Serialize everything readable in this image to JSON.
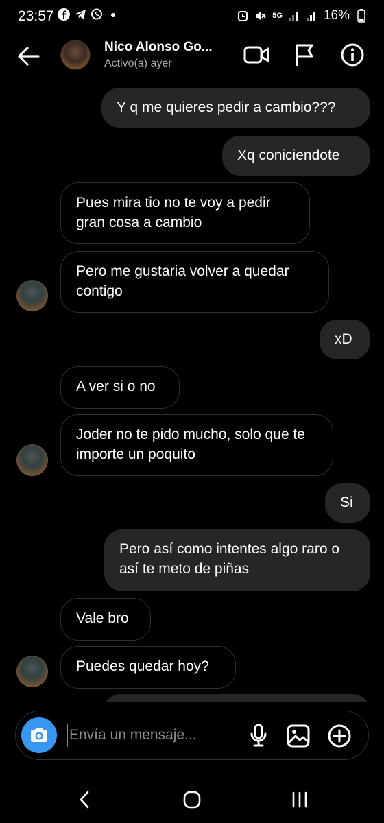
{
  "status_bar": {
    "time": "23:57",
    "battery": "16%",
    "network": "5G",
    "icons": [
      "facebook-icon",
      "telegram-icon",
      "whatsapp-icon",
      "dot-icon",
      "alarm-icon",
      "mute-icon",
      "signal-icon",
      "battery-icon"
    ]
  },
  "header": {
    "contact_name": "Nico Alonso Go...",
    "contact_status": "Activo(a) ayer",
    "icons": [
      "back-arrow-icon",
      "video-call-icon",
      "flag-icon",
      "info-icon"
    ]
  },
  "messages": [
    {
      "from": "me",
      "text": "Y q me quieres pedir a cambio???"
    },
    {
      "from": "me",
      "text": "Xq coniciendote"
    },
    {
      "from": "them",
      "text": "Pues mira tio no te voy a pedir gran cosa a cambio"
    },
    {
      "from": "them",
      "text": "Pero me gustaria volver a quedar contigo"
    },
    {
      "from": "me",
      "text": "xD"
    },
    {
      "from": "them",
      "text": "A ver si o no"
    },
    {
      "from": "them",
      "text": "Joder no te pido mucho, solo que te importe un poquito"
    },
    {
      "from": "me",
      "text": "Si"
    },
    {
      "from": "me",
      "text": "Pero así como intentes algo raro o así te meto de piñas"
    },
    {
      "from": "them",
      "text": "Vale bro"
    },
    {
      "from": "them",
      "text": "Puedes quedar hoy?"
    }
  ],
  "composer": {
    "placeholder": "Envía un mensaje...",
    "icons": [
      "camera-icon",
      "microphone-icon",
      "gallery-icon",
      "add-icon"
    ],
    "accent_color": "#3897f0"
  },
  "nav_bar": {
    "icons": [
      "back-nav-icon",
      "home-nav-icon",
      "recents-nav-icon"
    ]
  },
  "colors": {
    "background": "#000000",
    "sent_bubble": "#262626",
    "received_border": "#2f2f2f"
  }
}
